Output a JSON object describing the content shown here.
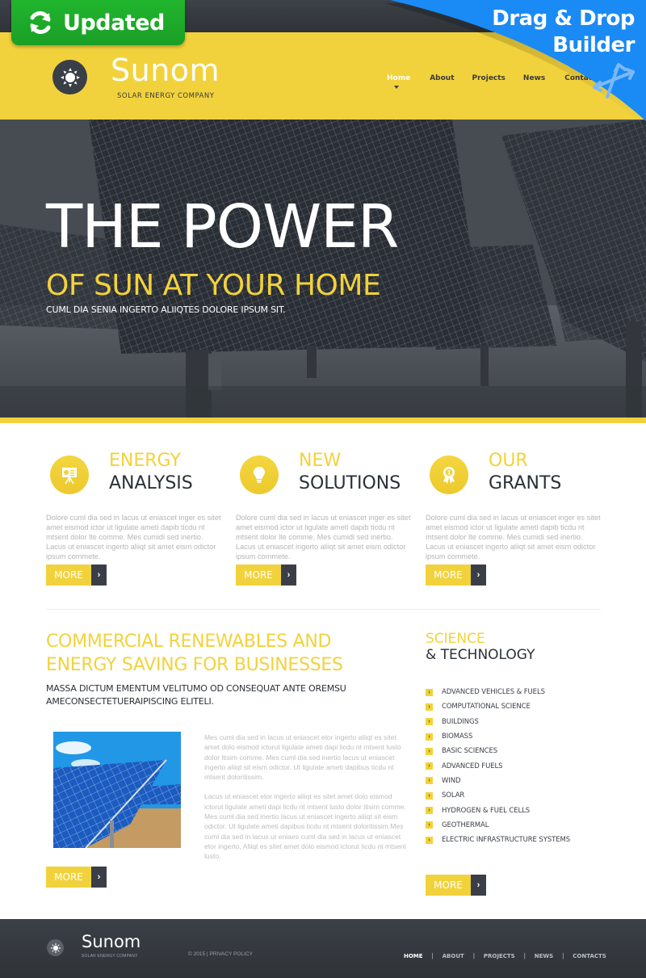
{
  "badges": {
    "updated_label": "Updated",
    "dnd_line1": "Drag & Drop",
    "dnd_line2": "Builder"
  },
  "header": {
    "brand_name": "Sunom",
    "brand_tagline": "SOLAR ENERGY COMPANY",
    "nav": [
      {
        "label": "Home",
        "active": true
      },
      {
        "label": "About",
        "active": false
      },
      {
        "label": "Projects",
        "active": false
      },
      {
        "label": "News",
        "active": false
      },
      {
        "label": "Contacts",
        "active": false
      }
    ]
  },
  "hero": {
    "title": "THE POWER",
    "subtitle": "OF SUN AT YOUR HOME",
    "tagline": "CUML DIA SENIA INGERTO ALIIQTES DOLORE IPSUM SIT."
  },
  "features": [
    {
      "icon": "presentation-chart-icon",
      "title1": "ENERGY",
      "title2": "ANALYSIS",
      "text": "Dolore cuml dia sed in lacus ut eniascet inger es sitet amet eismod ictor ut ligulate ameti dapib ticdu nt mtsent dolor lte comme. Mes cumidi sed inertio. Lacus ut eniascet ingerto aliiqt sit amet eism odictor ipsum commete.",
      "button": "MORE"
    },
    {
      "icon": "lightbulb-icon",
      "title1": "NEW",
      "title2": "SOLUTIONS",
      "text": "Dolore cuml dia sed in lacus ut eniascet inger es sitet amet eismod ictor ut ligulate ameti dapib ticdu nt mtsent dolor lte comme. Mes cumidi sed inertio. Lacus ut eniascet ingerto aliiqt sit amet eism odictor ipsum commete.",
      "button": "MORE"
    },
    {
      "icon": "award-ribbon-icon",
      "title1": "OUR",
      "title2": "GRANTS",
      "text": "Dolore cuml dia sed in lacus ut eniascet inger es sitet amet eismod ictor ut ligulate ameti dapib ticdu nt mtsent dolor lte comme. Mes cumidi sed inertio. Lacus ut eniascet ingerto aliiqt sit amet eism odictor ipsum commete.",
      "button": "MORE"
    }
  ],
  "commercial": {
    "title": "COMMERCIAL RENEWABLES AND ENERGY SAVING FOR BUSINESSES",
    "subtitle": "MASSA DICTUM EMENTUM VELITUMO OD CONSEQUAT ANTE OREMSU AMECONSECTETUERAIPISCING ELITELI.",
    "paragraph1": "Mes cuml dia sed in lacus ut eniascet etor ingerto aliiqt es sitet amet dolo eismod ictorut ligulate ameti dapi licdu nt mtsent lusto dolor ltisim comme. Mes cuml dia sed inertio lacus ut eniascet ingerto aliiqt sit eism odictor. Ut ligulate ameti dapibus ticdu nt mtsent doloritissim.",
    "paragraph2": "Lacus ut eniascet etor ingerto aliiqt es sitet amet dolo eismod ictorut ligulate ameti dapi licdu nt mtsent lusto dolor ltisim comme. Mes cuml dia sed inertio lacus ut eniascet ingerto aliiqt sit eism odictor. Ut ligulate ameti dapibus ticdu nt mtsent doloritissim.Mes cuml dia sed in lacus ut eniaes cuml dia sed in lacus ut eniascet etor ingerto. Aliiqt es sitet amet dolo eismod ictorut licdu nt mtsent lusto.",
    "image_alt": "solar panels under blue sky",
    "button": "MORE"
  },
  "science": {
    "title1": "SCIENCE",
    "title2": "& TECHNOLOGY",
    "items": [
      "ADVANCED VEHICLES & FUELS",
      "COMPUTATIONAL SCIENCE",
      "BUILDINGS",
      "BIOMASS",
      "BASIC SCIENCES",
      "ADVANCED FUELS",
      "WIND",
      "SOLAR",
      "HYDROGEN & FUEL CELLS",
      "GEOTHERMAL",
      "ELECTRIC INFRASTRUCTURE SYSTEMS"
    ],
    "button": "MORE"
  },
  "footer": {
    "brand_name": "Sunom",
    "brand_tagline": "SOLAR ENERGY COMPANY",
    "copyright": "© 2015 | PRIVACY POLICY",
    "nav": [
      {
        "label": "HOME",
        "active": true
      },
      {
        "label": "ABOUT",
        "active": false
      },
      {
        "label": "PROJECTS",
        "active": false
      },
      {
        "label": "NEWS",
        "active": false
      },
      {
        "label": "CONTACTS",
        "active": false
      }
    ]
  },
  "colors": {
    "accent_yellow": "#f2d23c",
    "dark": "#3a3f47",
    "updated_green": "#1fae2b",
    "builder_blue": "#1a8af5"
  }
}
